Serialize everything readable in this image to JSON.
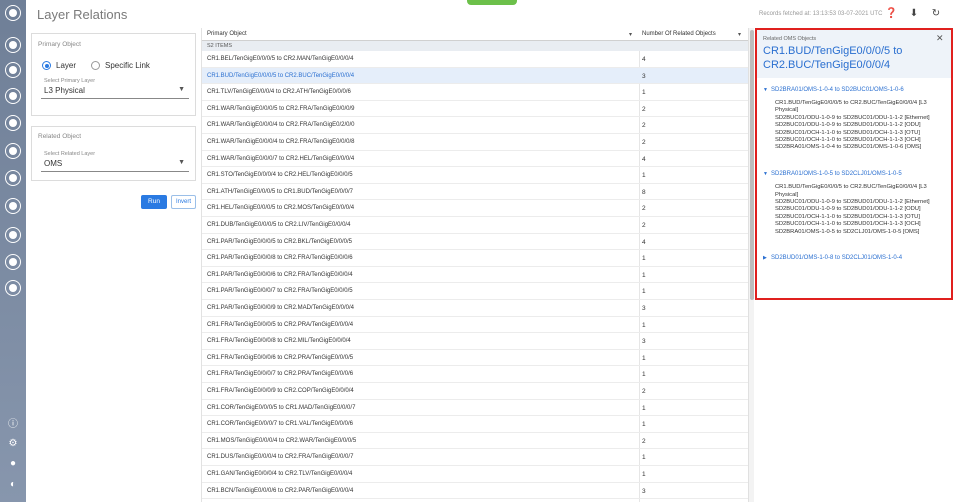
{
  "app": {
    "title": "Layer Relations",
    "fetched_text": "Records fetched at: 13:13:53 03-07-2021 UTC"
  },
  "colors": {
    "accent": "#2a7ae2",
    "highlight_border": "#e0201e",
    "rail": "#7b8aa2",
    "top_accent": "#6cc04a"
  },
  "rail_icons": [
    "app-icon",
    "gear-circle-icon",
    "sync-icon",
    "globe-icon",
    "chart-icon",
    "bars-icon",
    "globe-alt-icon",
    "network-icon",
    "badge-icon",
    "search-icon",
    "layers-icon"
  ],
  "top_icons": [
    "help-icon",
    "download-icon",
    "refresh-icon"
  ],
  "primary_panel": {
    "title": "Primary Object",
    "radio_layer": "Layer",
    "radio_specific": "Specific Link",
    "select_label": "Select Primary Layer",
    "select_value": "L3 Physical"
  },
  "related_panel": {
    "title": "Related Object",
    "select_label": "Select Related Layer",
    "select_value": "OMS"
  },
  "buttons": {
    "run": "Run",
    "invert": "Invert"
  },
  "table": {
    "col_primary": "Primary Object",
    "col_count": "Number Of Related Objects",
    "group_label": "S2 ITEMS",
    "rows": [
      {
        "obj": "CR1.BEL/TenGigE0/0/0/5 to CR2.MAN/TenGigE0/0/0/4",
        "count": "4"
      },
      {
        "obj": "CR1.BUD/TenGigE0/0/0/5 to CR2.BUC/TenGigE0/0/0/4",
        "count": "3"
      },
      {
        "obj": "CR1.TLV/TenGigE0/0/0/4 to CR2.ATH/TenGigE0/0/0/6",
        "count": "1"
      },
      {
        "obj": "CR1.WAR/TenGigE0/0/0/5 to CR2.FRA/TenGigE0/0/0/9",
        "count": "2"
      },
      {
        "obj": "CR1.WAR/TenGigE0/0/0/4 to CR2.FRA/TenGigE0/2/0/0",
        "count": "2"
      },
      {
        "obj": "CR1.WAR/TenGigE0/0/0/4 to CR2.FRA/TenGigE0/0/0/8",
        "count": "2"
      },
      {
        "obj": "CR1.WAR/TenGigE0/0/0/7 to CR2.HEL/TenGigE0/0/0/4",
        "count": "4"
      },
      {
        "obj": "CR1.STO/TenGigE0/0/0/4 to CR2.HEL/TenGigE0/0/0/5",
        "count": "1"
      },
      {
        "obj": "CR1.ATH/TenGigE0/0/0/5 to CR1.BUD/TenGigE0/0/0/7",
        "count": "8"
      },
      {
        "obj": "CR1.HEL/TenGigE0/0/0/5 to CR2.MOS/TenGigE0/0/0/4",
        "count": "2"
      },
      {
        "obj": "CR1.DUB/TenGigE0/0/0/5 to CR2.LIV/TenGigE0/0/0/4",
        "count": "2"
      },
      {
        "obj": "CR1.PAR/TenGigE0/0/0/5 to CR2.BKL/TenGigE0/0/0/5",
        "count": "4"
      },
      {
        "obj": "CR1.PAR/TenGigE0/0/0/8 to CR2.FRA/TenGigE0/0/0/6",
        "count": "1"
      },
      {
        "obj": "CR1.PAR/TenGigE0/0/0/6 to CR2.FRA/TenGigE0/0/0/4",
        "count": "1"
      },
      {
        "obj": "CR1.PAR/TenGigE0/0/0/7 to CR2.FRA/TenGigE0/0/0/5",
        "count": "1"
      },
      {
        "obj": "CR1.PAR/TenGigE0/0/0/9 to CR2.MAD/TenGigE0/0/0/4",
        "count": "3"
      },
      {
        "obj": "CR1.FRA/TenGigE0/0/0/5 to CR2.PRA/TenGigE0/0/0/4",
        "count": "1"
      },
      {
        "obj": "CR1.FRA/TenGigE0/0/0/8 to CR2.MIL/TenGigE0/0/0/4",
        "count": "3"
      },
      {
        "obj": "CR1.FRA/TenGigE0/0/0/6 to CR2.PRA/TenGigE0/0/0/5",
        "count": "1"
      },
      {
        "obj": "CR1.FRA/TenGigE0/0/0/7 to CR2.PRA/TenGigE0/0/0/6",
        "count": "1"
      },
      {
        "obj": "CR1.FRA/TenGigE0/0/0/9 to CR2.COP/TenGigE0/0/0/4",
        "count": "2"
      },
      {
        "obj": "CR1.COR/TenGigE0/0/0/5 to CR1.MAD/TenGigE0/0/0/7",
        "count": "1"
      },
      {
        "obj": "CR1.COR/TenGigE0/0/0/7 to CR1.VAL/TenGigE0/0/0/6",
        "count": "1"
      },
      {
        "obj": "CR1.MOS/TenGigE0/0/0/4 to CR2.WAR/TenGigE0/0/0/5",
        "count": "2"
      },
      {
        "obj": "CR1.DUS/TenGigE0/0/0/4 to CR2.FRA/TenGigE0/0/0/7",
        "count": "1"
      },
      {
        "obj": "CR1.GAN/TenGigE0/0/0/4 to CR2.TLV/TenGigE0/0/0/4",
        "count": "1"
      },
      {
        "obj": "CR1.BCN/TenGigE0/0/0/6 to CR2.PAR/TenGigE0/0/0/4",
        "count": "3"
      }
    ]
  },
  "related_panel_right": {
    "subtitle": "Related OMS Objects",
    "title": "CR1.BUD/TenGigE0/0/0/5 to CR2.BUC/TenGigE0/0/0/4",
    "nodes": [
      {
        "label": "SD2BRA01/OMS-1-0-4 to SD2BUC01/OMS-1-0-6",
        "expanded": true,
        "details": [
          "CR1.BUD/TenGigE0/0/0/5 to CR2.BUC/TenGigE0/0/0/4 [L3 Physical]",
          "SD2BUC01/ODU-1-0-9 to SD2BUC01/ODU-1-1-2 [Ethernet]",
          "SD2BUC01/ODU-1-0-9 to SD2BUD01/ODU-1-1-2 [ODU]",
          "SD2BUC01/OCH-1-1-0 to SD2BUD01/OCH-1-1-3 [OTU]",
          "SD2BUC01/OCH-1-1-0 to SD2BUD01/OCH-1-1-3 [OCH]",
          "SD2BRA01/OMS-1-0-4 to SD2BUC01/OMS-1-0-6 [OMS]"
        ]
      },
      {
        "label": "SD2BRA01/OMS-1-0-5 to SD2CLJ01/OMS-1-0-5",
        "expanded": true,
        "details": [
          "CR1.BUD/TenGigE0/0/0/5 to CR2.BUC/TenGigE0/0/0/4 [L3 Physical]",
          "SD2BUC01/ODU-1-0-9 to SD2BUD01/ODU-1-1-2 [Ethernet]",
          "SD2BUC01/ODU-1-0-9 to SD2BUD01/ODU-1-1-2 [ODU]",
          "SD2BUC01/OCH-1-1-0 to SD2BUD01/OCH-1-1-3 [OTU]",
          "SD2BUC01/OCH-1-1-0 to SD2BUD01/OCH-1-1-3 [OCH]",
          "SD2BRA01/OMS-1-0-5 to SD2CLJ01/OMS-1-0-5 [OMS]"
        ]
      },
      {
        "label": "SD2BUD01/OMS-1-0-8 to SD2CLJ01/OMS-1-0-4",
        "expanded": false,
        "details": []
      }
    ]
  }
}
